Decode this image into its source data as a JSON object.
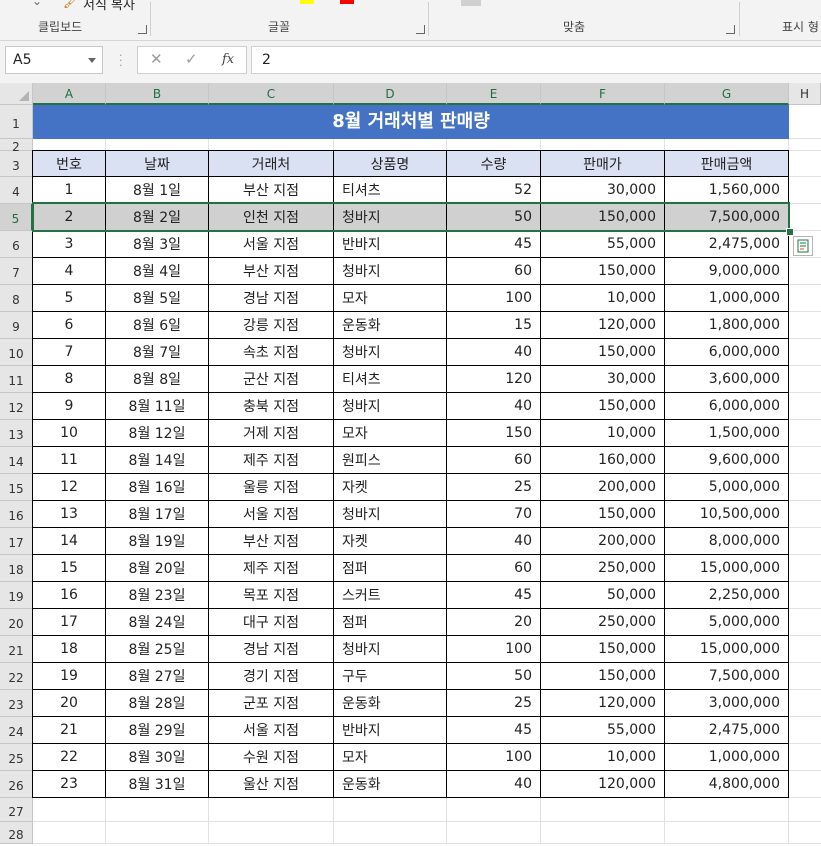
{
  "ribbon": {
    "format_painter": "서식 복사",
    "groups": [
      "클립보드",
      "글꼴",
      "맞춤",
      "표시 형"
    ]
  },
  "name_box": "A5",
  "formula_bar": {
    "value": "2",
    "cancel": "✕",
    "enter": "✓",
    "fx": "fx"
  },
  "columns": [
    "A",
    "B",
    "C",
    "D",
    "E",
    "F",
    "G",
    "H"
  ],
  "rows": [
    "1",
    "2",
    "3",
    "4",
    "5",
    "6",
    "7",
    "8",
    "9",
    "10",
    "11",
    "12",
    "13",
    "14",
    "15",
    "16",
    "17",
    "18",
    "19",
    "20",
    "21",
    "22",
    "23",
    "24",
    "25",
    "26",
    "27",
    "28"
  ],
  "selected_row": "5",
  "sheet": {
    "title": "8월 거래처별 판매량",
    "headers": [
      "번호",
      "날짜",
      "거래처",
      "상품명",
      "수량",
      "판매가",
      "판매금액"
    ],
    "records": [
      [
        "1",
        "8월 1일",
        "부산 지점",
        "티셔츠",
        "52",
        "30,000",
        "1,560,000"
      ],
      [
        "2",
        "8월 2일",
        "인천 지점",
        "청바지",
        "50",
        "150,000",
        "7,500,000"
      ],
      [
        "3",
        "8월 3일",
        "서울 지점",
        "반바지",
        "45",
        "55,000",
        "2,475,000"
      ],
      [
        "4",
        "8월 4일",
        "부산 지점",
        "청바지",
        "60",
        "150,000",
        "9,000,000"
      ],
      [
        "5",
        "8월 5일",
        "경남 지점",
        "모자",
        "100",
        "10,000",
        "1,000,000"
      ],
      [
        "6",
        "8월 6일",
        "강릉 지점",
        "운동화",
        "15",
        "120,000",
        "1,800,000"
      ],
      [
        "7",
        "8월 7일",
        "속초 지점",
        "청바지",
        "40",
        "150,000",
        "6,000,000"
      ],
      [
        "8",
        "8월 8일",
        "군산 지점",
        "티셔츠",
        "120",
        "30,000",
        "3,600,000"
      ],
      [
        "9",
        "8월 11일",
        "충북 지점",
        "청바지",
        "40",
        "150,000",
        "6,000,000"
      ],
      [
        "10",
        "8월 12일",
        "거제 지점",
        "모자",
        "150",
        "10,000",
        "1,500,000"
      ],
      [
        "11",
        "8월 14일",
        "제주 지점",
        "원피스",
        "60",
        "160,000",
        "9,600,000"
      ],
      [
        "12",
        "8월 16일",
        "울릉 지점",
        "자켓",
        "25",
        "200,000",
        "5,000,000"
      ],
      [
        "13",
        "8월 17일",
        "서울 지점",
        "청바지",
        "70",
        "150,000",
        "10,500,000"
      ],
      [
        "14",
        "8월 19일",
        "부산 지점",
        "자켓",
        "40",
        "200,000",
        "8,000,000"
      ],
      [
        "15",
        "8월 20일",
        "제주 지점",
        "점퍼",
        "60",
        "250,000",
        "15,000,000"
      ],
      [
        "16",
        "8월 23일",
        "목포 지점",
        "스커트",
        "45",
        "50,000",
        "2,250,000"
      ],
      [
        "17",
        "8월 24일",
        "대구 지점",
        "점퍼",
        "20",
        "250,000",
        "5,000,000"
      ],
      [
        "18",
        "8월 25일",
        "경남 지점",
        "청바지",
        "100",
        "150,000",
        "15,000,000"
      ],
      [
        "19",
        "8월 27일",
        "경기 지점",
        "구두",
        "50",
        "150,000",
        "7,500,000"
      ],
      [
        "20",
        "8월 28일",
        "군포 지점",
        "운동화",
        "25",
        "120,000",
        "3,000,000"
      ],
      [
        "21",
        "8월 29일",
        "서울 지점",
        "반바지",
        "45",
        "55,000",
        "2,475,000"
      ],
      [
        "22",
        "8월 30일",
        "수원 지점",
        "모자",
        "100",
        "10,000",
        "1,000,000"
      ],
      [
        "23",
        "8월 31일",
        "울산 지점",
        "운동화",
        "40",
        "120,000",
        "4,800,000"
      ]
    ]
  },
  "colors": {
    "title_fill": "#4472c4",
    "header_fill": "#d9e1f2",
    "selection": "#217346"
  }
}
